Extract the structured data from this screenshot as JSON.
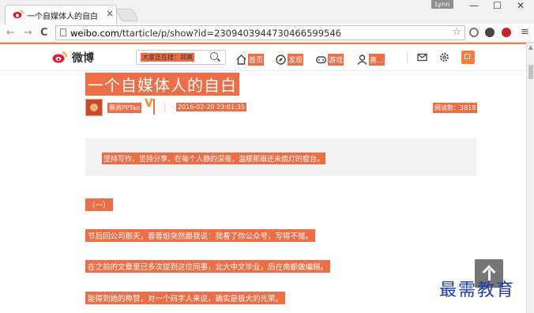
{
  "browser": {
    "tab_title": "一个自媒体人的自白",
    "tab_close": "×",
    "profile_name": "Lynn",
    "minimize": "—",
    "maximize": "☐",
    "close": "✕",
    "back": "←",
    "forward": "→",
    "reload": "C",
    "url_host": "weibo.com",
    "url_path": "/ttarticle/p/show?id=2309403944730466599546",
    "bookmark_star": "☆",
    "menu_icon": "≡"
  },
  "weibo_header": {
    "logo_text": "微博",
    "search_placeholder": "大家正在搜：郑爽",
    "nav": [
      {
        "label": "首页",
        "icon": "home-icon"
      },
      {
        "label": "发现",
        "icon": "discover-icon"
      },
      {
        "label": "游戏",
        "icon": "game-icon"
      },
      {
        "label": "喜...",
        "icon": "user-icon"
      }
    ],
    "tools": [
      "mail-icon",
      "settings-icon",
      "compose-icon"
    ]
  },
  "article": {
    "title": "一个自媒体人的自白",
    "author": "蓉将PPTao",
    "verified_mark": "V",
    "date": "2016-02-20 23:01:35",
    "reads": "阅读数：3818",
    "summary": "坚持写作，坚持分享，在每个人静的深夜，温暖那扇还未熄灯的窗台。",
    "paragraphs": [
      "（一）",
      "节后回公司那天，蓉蓉姐突然跟我说：我看了你公众号，写得不错。",
      "在之前的文章里已多次提到这位同事，北大中文毕业，后在南都做编辑。",
      "能得到她的称赞，对一个码字人来说，确实是极大的光荣。"
    ]
  },
  "watermark": "最需教育",
  "colors": {
    "weibo_orange": "#fa7d3c",
    "highlight": "#ec6e46",
    "watermark": "#1f3ca6"
  }
}
